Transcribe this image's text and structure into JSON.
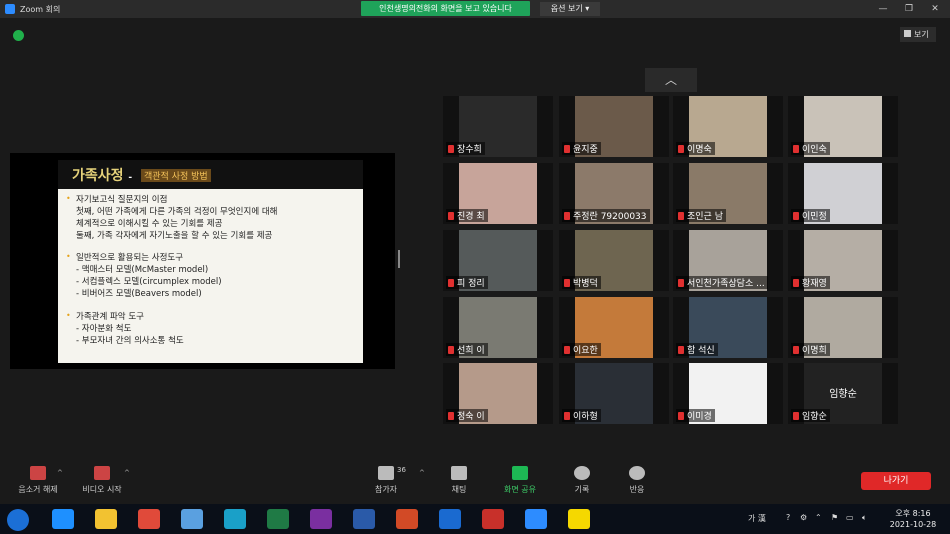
{
  "window": {
    "title": "Zoom 회의"
  },
  "share_banner": "인천생명의전화의 화면을 보고 있습니다",
  "view_options": "옵션 보기",
  "window_controls": [
    "—",
    "❐",
    "✕"
  ],
  "view_button": "보기",
  "scroll_up_label": "︿",
  "slide": {
    "title": "가족사정",
    "title_dash": "-",
    "subtitle": "객관적 사정 방법",
    "bullet_glyph": "•",
    "sections": [
      {
        "lines": [
          "자기보고식 질문지의 이점",
          "첫째, 어떤 가족에게 다른 가족의 걱정이 무엇인지에 대해",
          "체계적으로 이해시킬 수 있는 기회를 제공",
          "둘째, 가족 각자에게 자기노출을 할 수 있는 기회를 제공"
        ]
      },
      {
        "lines": [
          "일반적으로 활용되는 사정도구",
          "- 맥매스터 모델(McMaster model)",
          "- 서컴플렉스 모델(circumplex model)",
          "- 비버어즈 모델(Beavers model)"
        ]
      },
      {
        "lines": [
          "가족관계 파악 도구",
          "- 자아분화 척도",
          "- 부모자녀 간의 의사소통 척도"
        ]
      }
    ]
  },
  "participants": [
    {
      "name": "장수희",
      "bg": "#2a2a2a"
    },
    {
      "name": "윤지중",
      "bg": "#6b5a4a"
    },
    {
      "name": "이명숙",
      "bg": "#b8a890"
    },
    {
      "name": "이인숙",
      "bg": "#c9c2b8"
    },
    {
      "name": "진경 최",
      "bg": "#c7a49a"
    },
    {
      "name": "주정란 79200033",
      "bg": "#8c7a6a"
    },
    {
      "name": "조인근 남",
      "bg": "#8a7a68"
    },
    {
      "name": "이민정",
      "bg": "#d0d0d4"
    },
    {
      "name": "피 정리",
      "bg": "#555a5a"
    },
    {
      "name": "박병덕",
      "bg": "#6e6550"
    },
    {
      "name": "서인천가족상담소 ...",
      "bg": "#a8a29a"
    },
    {
      "name": "황재영",
      "bg": "#b5aea5"
    },
    {
      "name": "선희 이",
      "bg": "#7a7a72"
    },
    {
      "name": "이요한",
      "bg": "#c47a3a"
    },
    {
      "name": "함 석신",
      "bg": "#3a4a5a"
    },
    {
      "name": "이명희",
      "bg": "#b0aaa0"
    },
    {
      "name": "정숙 이",
      "bg": "#b59a8a"
    },
    {
      "name": "이하형",
      "bg": "#2a2f36"
    },
    {
      "name": "이미경",
      "bg": "#f2f2f2"
    },
    {
      "name": "임향순",
      "bg": "#222222",
      "center_label": "임향순"
    }
  ],
  "toolbar": {
    "mute": "음소거 해제",
    "video": "비디오 시작",
    "participants": "참가자",
    "participants_count": "36",
    "chat": "채팅",
    "share": "화면 공유",
    "record": "기록",
    "reactions": "반응",
    "leave": "나가기",
    "caret": "^"
  },
  "taskbar": {
    "ime": "가 漢",
    "time": "오후 8:16",
    "date": "2021-10-28",
    "apps": [
      {
        "name": "media-app-icon",
        "color": "#1e90ff"
      },
      {
        "name": "file-explorer-icon",
        "color": "#f2c231"
      },
      {
        "name": "chrome-icon",
        "color": "#e04a3a"
      },
      {
        "name": "people-app-icon",
        "color": "#5aa0e0"
      },
      {
        "name": "edge-icon",
        "color": "#1aa0c8"
      },
      {
        "name": "excel-icon",
        "color": "#1f7a45"
      },
      {
        "name": "onenote-icon",
        "color": "#7a2fa0"
      },
      {
        "name": "word-icon",
        "color": "#2a5aa8"
      },
      {
        "name": "powerpoint-icon",
        "color": "#d24a26"
      },
      {
        "name": "outlook-icon",
        "color": "#1a6ad0"
      },
      {
        "name": "snipping-tool-icon",
        "color": "#c8302a"
      },
      {
        "name": "zoom-icon",
        "color": "#2d8cff"
      },
      {
        "name": "kakaotalk-icon",
        "color": "#f5d800"
      }
    ]
  }
}
